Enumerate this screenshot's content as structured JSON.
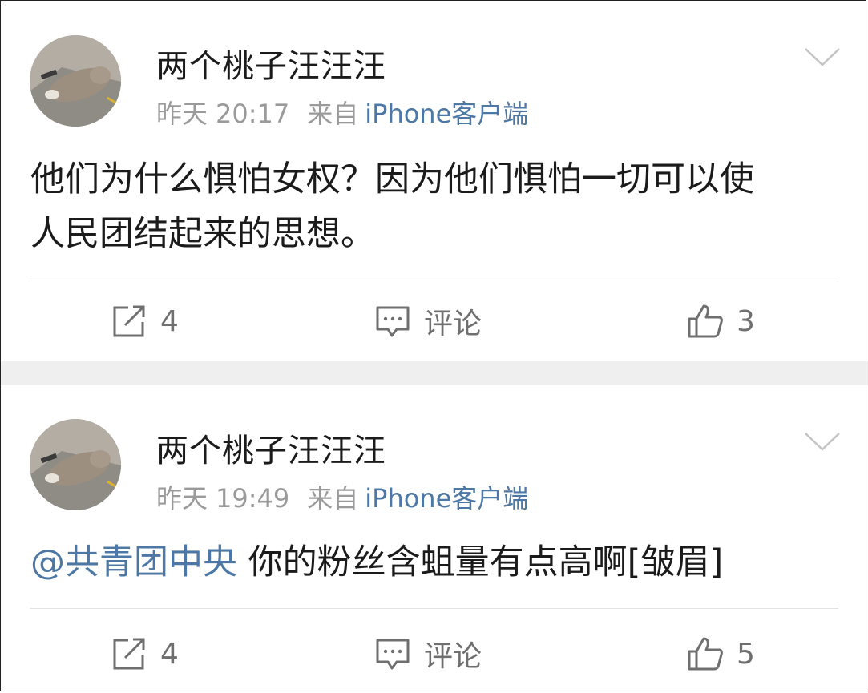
{
  "posts": [
    {
      "username": "两个桃子汪汪汪",
      "date": "昨天",
      "time": "20:17",
      "from_label": "来自",
      "source": "iPhone客户端",
      "content_lines": [
        "他们为什么惧怕女权？因为他们惧怕一切可以使",
        "人民团结起来的思想。"
      ],
      "repost_count": "4",
      "comment_label": "评论",
      "like_count": "3"
    },
    {
      "username": "两个桃子汪汪汪",
      "date": "昨天",
      "time": "19:49",
      "from_label": "来自",
      "source": "iPhone客户端",
      "mention": "@共青团中央",
      "content_text": "你的粉丝含蛆量有点高啊[皱眉]",
      "repost_count": "4",
      "comment_label": "评论",
      "like_count": "5"
    }
  ],
  "icons": {
    "avatar": "avatar-cat-photo",
    "menu": "chevron-down-icon",
    "repost": "share-icon",
    "comment": "comment-icon",
    "like": "thumbs-up-icon"
  },
  "colors": {
    "text": "#1b1b1b",
    "meta": "#9a9a9a",
    "link": "#4d78a6",
    "action": "#6f6f6f",
    "separator": "#efefef"
  }
}
